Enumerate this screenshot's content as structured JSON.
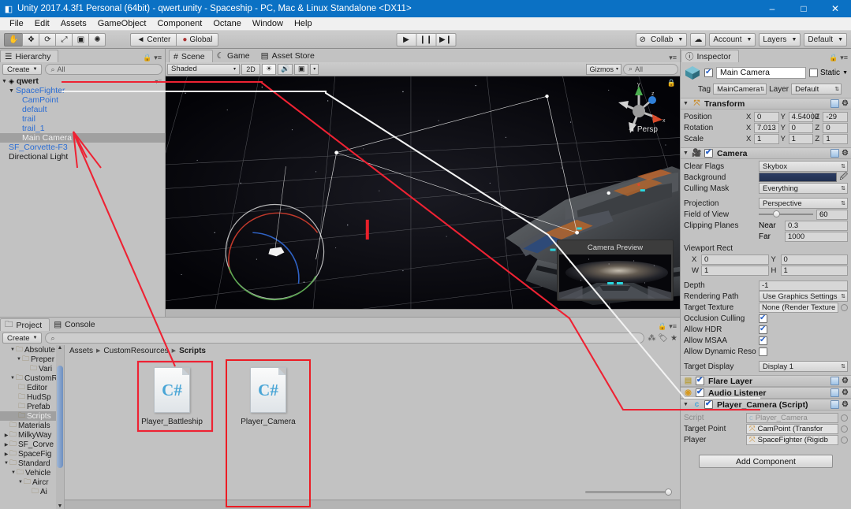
{
  "window": {
    "title": "Unity 2017.4.3f1 Personal (64bit) - qwert.unity - Spaceship - PC, Mac & Linux Standalone <DX11>",
    "app_icon": "unity-icon",
    "minimize": "–",
    "maximize": "□",
    "close": "✕"
  },
  "menu": [
    "File",
    "Edit",
    "Assets",
    "GameObject",
    "Component",
    "Octane",
    "Window",
    "Help"
  ],
  "toolbar": {
    "tools": [
      {
        "name": "hand-tool",
        "glyph": "✋",
        "active": true
      },
      {
        "name": "move-tool",
        "glyph": "✥",
        "active": false
      },
      {
        "name": "rotate-tool",
        "glyph": "⟳",
        "active": false
      },
      {
        "name": "scale-tool",
        "glyph": "⤢",
        "active": false
      },
      {
        "name": "rect-tool",
        "glyph": "▣",
        "active": false
      },
      {
        "name": "transform-tool",
        "glyph": "✺",
        "active": false
      }
    ],
    "pivot": "Center",
    "handle": "Global",
    "play": "▶",
    "pause": "❙❙",
    "step": "▶❙",
    "collab": "Collab",
    "cloud": "☁",
    "account": "Account",
    "layers": "Layers",
    "layout": "Default"
  },
  "hierarchy": {
    "tab": "Hierarchy",
    "create": "Create",
    "search_placeholder": "All",
    "scene_root": "qwert",
    "items": [
      {
        "label": "SpaceFighter",
        "depth": 1,
        "expanded": true,
        "style": "prefab",
        "selected": false
      },
      {
        "label": "CamPoint",
        "depth": 2,
        "expanded": null,
        "style": "prefab",
        "selected": false
      },
      {
        "label": "default",
        "depth": 2,
        "expanded": null,
        "style": "prefab",
        "selected": false
      },
      {
        "label": "trail",
        "depth": 2,
        "expanded": null,
        "style": "prefab",
        "selected": false
      },
      {
        "label": "trail_1",
        "depth": 2,
        "expanded": null,
        "style": "prefab",
        "selected": false
      },
      {
        "label": "Main Camera",
        "depth": 2,
        "expanded": null,
        "style": "prefab",
        "selected": true
      },
      {
        "label": "SF_Corvette-F3",
        "depth": 1,
        "expanded": null,
        "style": "prefab",
        "selected": false
      },
      {
        "label": "Directional Light",
        "depth": 1,
        "expanded": null,
        "style": "plain",
        "selected": false
      }
    ]
  },
  "scene": {
    "tabs": [
      {
        "label": "Scene",
        "icon": "scene-icon",
        "active": true
      },
      {
        "label": "Game",
        "icon": "game-icon",
        "active": false
      },
      {
        "label": "Asset Store",
        "icon": "store-icon",
        "active": false
      }
    ],
    "draw_mode": "Shaded",
    "two_d": "2D",
    "lighting_icon": "☀",
    "audio_icon": "🔊",
    "fx_icon": "▣",
    "gizmos": "Gizmos",
    "search_placeholder": "All",
    "persp_label": "Persp",
    "axis_labels": {
      "x": "x",
      "y": "y",
      "z": "z"
    },
    "camera_preview_title": "Camera Preview"
  },
  "project": {
    "tabs": [
      {
        "label": "Project",
        "icon": "folder-icon",
        "active": true
      },
      {
        "label": "Console",
        "icon": "console-icon",
        "active": false
      }
    ],
    "create": "Create",
    "search_placeholder": "",
    "breadcrumb": [
      "Assets",
      "CustomResources",
      "Scripts"
    ],
    "folders": [
      {
        "label": "Absolute",
        "depth": 1,
        "arrow": "▼",
        "selected": false
      },
      {
        "label": "Preper",
        "depth": 2,
        "arrow": "▼",
        "selected": false
      },
      {
        "label": "Vari",
        "depth": 3,
        "arrow": "",
        "selected": false
      },
      {
        "label": "CustomR",
        "depth": 1,
        "arrow": "▼",
        "selected": false
      },
      {
        "label": "Editor",
        "depth": 2,
        "arrow": "",
        "selected": false
      },
      {
        "label": "HudSp",
        "depth": 2,
        "arrow": "",
        "selected": false
      },
      {
        "label": "Prefab",
        "depth": 2,
        "arrow": "",
        "selected": false
      },
      {
        "label": "Scripts",
        "depth": 2,
        "arrow": "",
        "selected": true
      },
      {
        "label": "Materials",
        "depth": 1,
        "arrow": "",
        "selected": false
      },
      {
        "label": "MilkyWay",
        "depth": 1,
        "arrow": "▶",
        "selected": false
      },
      {
        "label": "SF_Corve",
        "depth": 1,
        "arrow": "▶",
        "selected": false
      },
      {
        "label": "SpaceFig",
        "depth": 1,
        "arrow": "▶",
        "selected": false
      },
      {
        "label": "Standard",
        "depth": 1,
        "arrow": "▼",
        "selected": false
      },
      {
        "label": "Vehicle",
        "depth": 2,
        "arrow": "▼",
        "selected": false
      },
      {
        "label": "Aircr",
        "depth": 3,
        "arrow": "▼",
        "selected": false
      },
      {
        "label": "Ai",
        "depth": 4,
        "arrow": "",
        "selected": false
      }
    ],
    "assets": [
      {
        "name": "Player_Battleship",
        "type": "C#",
        "highlighted": false
      },
      {
        "name": "Player_Camera",
        "type": "C#",
        "highlighted": true
      }
    ]
  },
  "inspector": {
    "tab": "Inspector",
    "object_name": "Main Camera",
    "object_enabled": true,
    "static_label": "Static",
    "static_checked": false,
    "tag_label": "Tag",
    "tag_value": "MainCamera",
    "layer_label": "Layer",
    "layer_value": "Default",
    "transform": {
      "title": "Transform",
      "rows": [
        {
          "label": "Position",
          "x": "0",
          "y": "4.54000",
          "z": "-29"
        },
        {
          "label": "Rotation",
          "x": "7.013",
          "y": "0",
          "z": "0"
        },
        {
          "label": "Scale",
          "x": "1",
          "y": "1",
          "z": "1"
        }
      ]
    },
    "camera": {
      "title": "Camera",
      "enabled": true,
      "clear_flags_label": "Clear Flags",
      "clear_flags_value": "Skybox",
      "background_label": "Background",
      "background_color": "#2b3c63",
      "culling_mask_label": "Culling Mask",
      "culling_mask_value": "Everything",
      "projection_label": "Projection",
      "projection_value": "Perspective",
      "fov_label": "Field of View",
      "fov_value": "60",
      "clipping_label": "Clipping Planes",
      "near_label": "Near",
      "near_value": "0.3",
      "far_label": "Far",
      "far_value": "1000",
      "viewport_label": "Viewport Rect",
      "viewport_x_label": "X",
      "viewport_x": "0",
      "viewport_y_label": "Y",
      "viewport_y": "0",
      "viewport_w_label": "W",
      "viewport_w": "1",
      "viewport_h_label": "H",
      "viewport_h": "1",
      "depth_label": "Depth",
      "depth_value": "-1",
      "rendering_path_label": "Rendering Path",
      "rendering_path_value": "Use Graphics Settings",
      "target_texture_label": "Target Texture",
      "target_texture_value": "None (Render Texture",
      "occlusion_label": "Occlusion Culling",
      "occlusion_checked": true,
      "hdr_label": "Allow HDR",
      "hdr_checked": true,
      "msaa_label": "Allow MSAA",
      "msaa_checked": true,
      "dynres_label": "Allow Dynamic Reso",
      "dynres_checked": false,
      "target_display_label": "Target Display",
      "target_display_value": "Display 1"
    },
    "flare_layer": {
      "title": "Flare Layer",
      "enabled": true
    },
    "audio_listener": {
      "title": "Audio Listener",
      "enabled": true
    },
    "player_camera": {
      "title": "Player_Camera (Script)",
      "enabled": true,
      "script_label": "Script",
      "script_value": "Player_Camera",
      "target_point_label": "Target Point",
      "target_point_value": "CamPoint (Transfor",
      "player_label": "Player",
      "player_value": "SpaceFighter (Rigidb"
    },
    "add_component": "Add Component"
  },
  "annotations": {
    "line_color": "#ee2233",
    "white_line_color": "#f5f5f5",
    "description": "red and white connector lines linking hierarchy, scene, project asset and inspector script fields"
  }
}
